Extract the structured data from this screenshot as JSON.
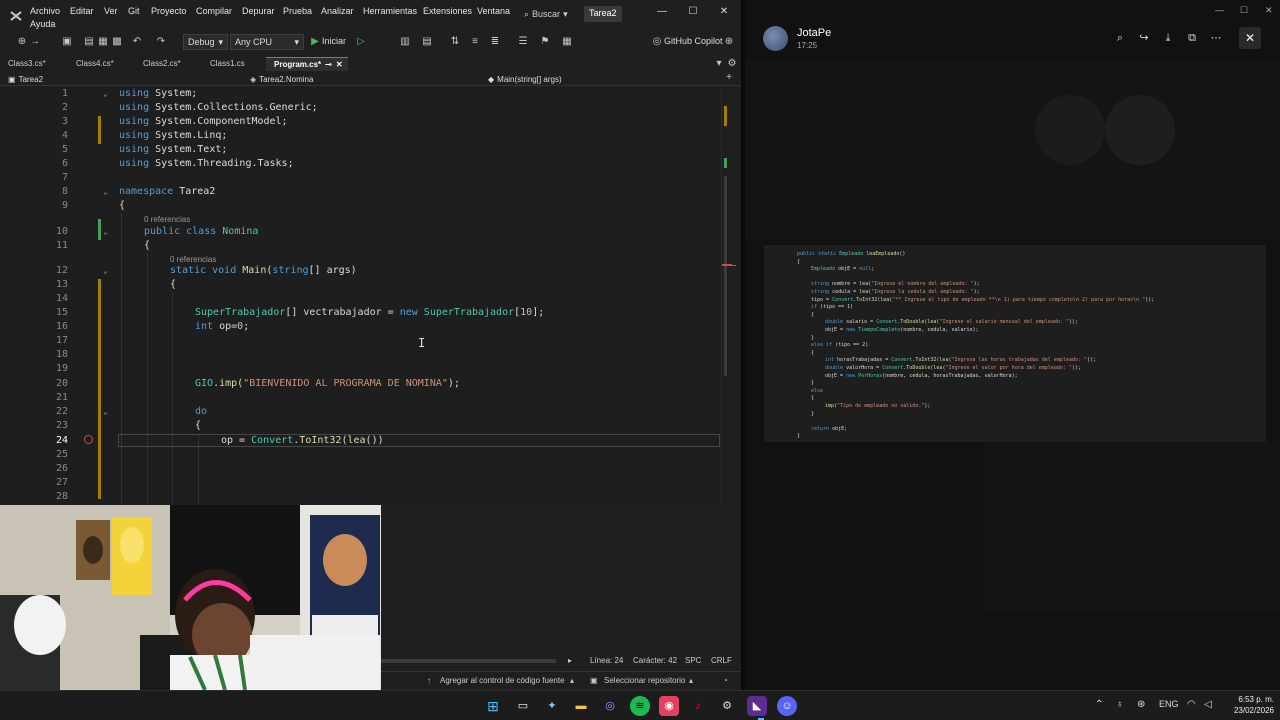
{
  "vs": {
    "menu": [
      "Archivo",
      "Editar",
      "Ver",
      "Git",
      "Proyecto",
      "Compilar",
      "Depurar",
      "Prueba",
      "Analizar",
      "Herramientas",
      "Extensiones",
      "Ventana",
      "Ayuda"
    ],
    "search_label": "Buscar",
    "project_badge": "Tarea2",
    "toolbar": {
      "config": "Debug",
      "platform": "Any CPU",
      "start": "Iniciar",
      "copilot": "GitHub Copilot"
    },
    "tabs": [
      {
        "label": "Class3.cs*",
        "active": false
      },
      {
        "label": "Class4.cs*",
        "active": false
      },
      {
        "label": "Class2.cs*",
        "active": false
      },
      {
        "label": "Class1.cs",
        "active": false
      },
      {
        "label": "Program.cs*",
        "active": true
      }
    ],
    "nav": {
      "project": "Tarea2",
      "type": "Tarea2.Nomina",
      "member": "Main(string[] args)"
    },
    "references_label": "0 referencias",
    "line_numbers": [
      "1",
      "2",
      "3",
      "4",
      "5",
      "6",
      "7",
      "8",
      "9",
      "10",
      "11",
      "12",
      "13",
      "14",
      "15",
      "16",
      "17",
      "18",
      "19",
      "20",
      "21",
      "22",
      "23",
      "24",
      "25",
      "26",
      "27",
      "28"
    ],
    "code": {
      "l1_kw": "using",
      "l1_rest": " System;",
      "l2_kw": "using",
      "l2_rest": " System.Collections.Generic;",
      "l3_kw": "using",
      "l3_rest": " System.ComponentModel;",
      "l4_kw": "using",
      "l4_rest": " System.Linq;",
      "l5_kw": "using",
      "l5_rest": " System.Text;",
      "l6_kw": "using",
      "l6_rest": " System.Threading.Tasks;",
      "l8_kw": "namespace",
      "l8_rest": " Tarea2",
      "l9": "{",
      "l10_kw": "public class",
      "l10_ty": "Nomina",
      "l11": "{",
      "l12_kw": "static void",
      "l12_mt": "Main",
      "l12_p1": "(",
      "l12_kw2": "string",
      "l12_p2": "[] args)",
      "l13": "{",
      "l15_ty": "SuperTrabajador",
      "l15_p1": "[] vectrabajador = ",
      "l15_kw": "new",
      "l15_ty2": "SuperTrabajador",
      "l15_p2": "[",
      "l15_nm": "10",
      "l15_p3": "];",
      "l16_kw": "int",
      "l16_p1": " op=",
      "l16_nm": "0",
      "l16_p2": ";",
      "l20_ty": "GIO",
      "l20_p1": ".",
      "l20_mt": "imp",
      "l20_p2": "(",
      "l20_st": "\"BIENVENIDO AL PROGRAMA DE NOMINA\"",
      "l20_p3": ");",
      "l22_kw": "do",
      "l23": "{",
      "l24_p1": "op = ",
      "l24_ty": "Convert",
      "l24_p2": ".",
      "l24_mt": "ToInt32",
      "l24_p3": "(",
      "l24_mt2": "lea",
      "l24_p4": "())"
    },
    "status": {
      "line": "Línea: 24",
      "char": "Carácter: 42",
      "spc": "SPC",
      "crlf": "CRLF",
      "add_source": "Agregar al control de código fuente",
      "select_repo": "Seleccionar repositorio"
    }
  },
  "viewer": {
    "name": "JotaPe",
    "time": "17:25",
    "shot_code": [
      {
        "i": 0,
        "parts": [
          [
            "s-kw",
            "public static "
          ],
          [
            "s-ty",
            "Empleado "
          ],
          [
            "s-mt",
            "leaEmpleado"
          ],
          [
            "",
            "()"
          ]
        ]
      },
      {
        "i": 0,
        "parts": [
          [
            "",
            "{"
          ]
        ]
      },
      {
        "i": 1,
        "parts": [
          [
            "s-ty",
            "Empleado "
          ],
          [
            "",
            "objE = "
          ],
          [
            "s-kw",
            "null"
          ],
          [
            "",
            ";"
          ]
        ]
      },
      {
        "i": 1,
        "parts": [
          [
            "",
            ""
          ]
        ]
      },
      {
        "i": 1,
        "parts": [
          [
            "s-kw",
            "string "
          ],
          [
            "",
            "nombre = "
          ],
          [
            "s-mt",
            "lea"
          ],
          [
            "",
            "("
          ],
          [
            "s-st",
            "\"Ingrese el nombre del empleado: \""
          ],
          [
            "",
            ");"
          ]
        ]
      },
      {
        "i": 1,
        "parts": [
          [
            "s-kw",
            "string "
          ],
          [
            "",
            "cedula = "
          ],
          [
            "s-mt",
            "lea"
          ],
          [
            "",
            "("
          ],
          [
            "s-st",
            "\"Ingrese la cedula del empleado: \""
          ],
          [
            "",
            ");"
          ]
        ]
      },
      {
        "i": 1,
        "parts": [
          [
            "",
            "tipo = "
          ],
          [
            "s-ty",
            "Convert"
          ],
          [
            "",
            "."
          ],
          [
            "s-mt",
            "ToInt32"
          ],
          [
            "",
            "("
          ],
          [
            "s-mt",
            "lea"
          ],
          [
            "",
            "("
          ],
          [
            "s-st",
            "\"** Ingrese el tipo de empleado **\\n 1) para tiempo completo\\n 2) para por horas\\n \""
          ],
          [
            "",
            "));"
          ]
        ]
      },
      {
        "i": 1,
        "parts": [
          [
            "s-kw",
            "if "
          ],
          [
            "",
            "(tipo == 1)"
          ]
        ]
      },
      {
        "i": 1,
        "parts": [
          [
            "",
            "{"
          ]
        ]
      },
      {
        "i": 2,
        "parts": [
          [
            "s-kw",
            "double "
          ],
          [
            "",
            "salario = "
          ],
          [
            "s-ty",
            "Convert"
          ],
          [
            "",
            "."
          ],
          [
            "s-mt",
            "ToDouble"
          ],
          [
            "",
            "("
          ],
          [
            "s-mt",
            "lea"
          ],
          [
            "",
            "("
          ],
          [
            "s-st",
            "\"Ingrese el salario mensual del empleado: \""
          ],
          [
            "",
            "));"
          ]
        ]
      },
      {
        "i": 2,
        "parts": [
          [
            "",
            "objE = "
          ],
          [
            "s-kw",
            "new "
          ],
          [
            "s-ty",
            "TiempoCompleto"
          ],
          [
            "",
            "(nombre, cedula, salario);"
          ]
        ]
      },
      {
        "i": 1,
        "parts": [
          [
            "",
            "}"
          ]
        ]
      },
      {
        "i": 1,
        "parts": [
          [
            "s-kw",
            "else if "
          ],
          [
            "",
            "(tipo == 2)"
          ]
        ]
      },
      {
        "i": 1,
        "parts": [
          [
            "",
            "{"
          ]
        ]
      },
      {
        "i": 2,
        "parts": [
          [
            "s-kw",
            "int "
          ],
          [
            "",
            "horasTrabajadas = "
          ],
          [
            "s-ty",
            "Convert"
          ],
          [
            "",
            "."
          ],
          [
            "s-mt",
            "ToInt32"
          ],
          [
            "",
            "("
          ],
          [
            "s-mt",
            "lea"
          ],
          [
            "",
            "("
          ],
          [
            "s-st",
            "\"Ingrese las horas trabajadas del empleado: \""
          ],
          [
            "",
            "));"
          ]
        ]
      },
      {
        "i": 2,
        "parts": [
          [
            "s-kw",
            "double "
          ],
          [
            "",
            "valorHora = "
          ],
          [
            "s-ty",
            "Convert"
          ],
          [
            "",
            "."
          ],
          [
            "s-mt",
            "ToDouble"
          ],
          [
            "",
            "("
          ],
          [
            "s-mt",
            "lea"
          ],
          [
            "",
            "("
          ],
          [
            "s-st",
            "\"Ingrese el valor por hora del empleado: \""
          ],
          [
            "",
            "));"
          ]
        ]
      },
      {
        "i": 2,
        "parts": [
          [
            "",
            "objE = "
          ],
          [
            "s-kw",
            "new "
          ],
          [
            "s-ty",
            "PorHoras"
          ],
          [
            "",
            "(nombre, cedula, horasTrabajadas, valorHora);"
          ]
        ]
      },
      {
        "i": 1,
        "parts": [
          [
            "",
            "}"
          ]
        ]
      },
      {
        "i": 1,
        "parts": [
          [
            "s-kw",
            "else"
          ]
        ]
      },
      {
        "i": 1,
        "parts": [
          [
            "",
            "{"
          ]
        ]
      },
      {
        "i": 2,
        "parts": [
          [
            "s-mt",
            "imp"
          ],
          [
            "",
            "("
          ],
          [
            "s-st",
            "\"Tipo de empleado no valido.\""
          ],
          [
            "",
            ");"
          ]
        ]
      },
      {
        "i": 1,
        "parts": [
          [
            "",
            "}"
          ]
        ]
      },
      {
        "i": 1,
        "parts": [
          [
            "",
            ""
          ]
        ]
      },
      {
        "i": 1,
        "parts": [
          [
            "s-kw",
            "return "
          ],
          [
            "",
            "objE;"
          ]
        ]
      },
      {
        "i": 0,
        "parts": [
          [
            "",
            "}"
          ]
        ]
      }
    ]
  },
  "taskbar": {
    "lang": "ENG",
    "time": "6:53 p. m.",
    "date": "23/02/2026"
  }
}
